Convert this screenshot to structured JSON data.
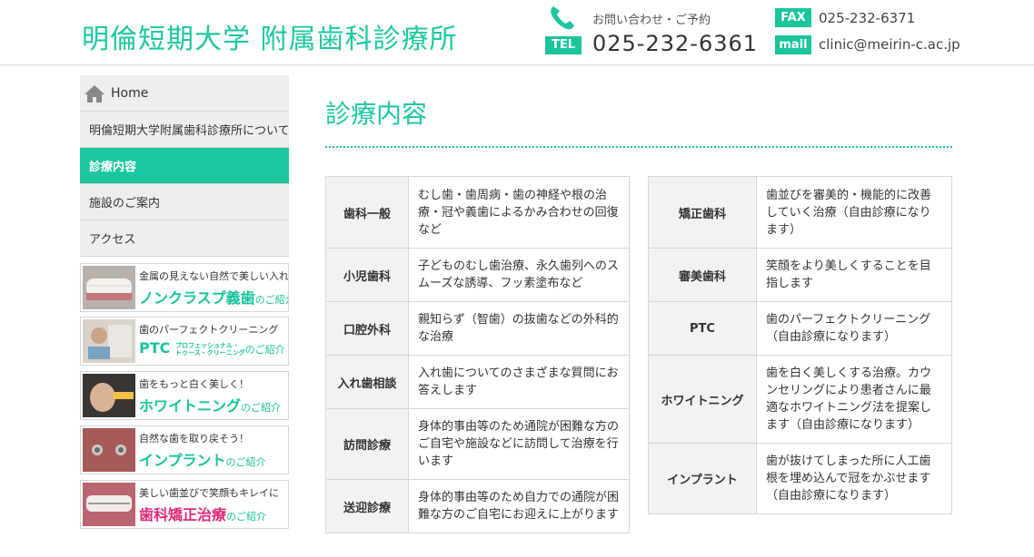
{
  "header": {
    "site_title": "明倫短期大学 附属歯科診療所",
    "inquiry_label": "お問い合わせ・ご予約",
    "tel_label": "TEL",
    "tel_number": "025-232-6361",
    "fax_label": "FAX",
    "fax_number": "025-232-6371",
    "mail_label": "mail",
    "mail_address": "clinic@meirin-c.ac.jp"
  },
  "nav": {
    "items": [
      {
        "label": "Home"
      },
      {
        "label": "明倫短期大学附属歯科診療所について"
      },
      {
        "label": "診療内容",
        "active": true
      },
      {
        "label": "施設のご案内"
      },
      {
        "label": "アクセス"
      }
    ]
  },
  "banners": [
    {
      "sub": "金属の見えない自然で美しい入れ歯",
      "main": "ノンクラスプ義歯",
      "intro": "のご紹介"
    },
    {
      "sub": "歯のパーフェクトクリーニング",
      "main": "PTC",
      "small1": "プロフェッショナル・",
      "small2": "トゥース・クリーニング",
      "intro": "のご紹介"
    },
    {
      "sub": "歯をもっと白く美しく！",
      "main": "ホワイトニング",
      "intro": "のご紹介"
    },
    {
      "sub": "自然な歯を取り戻そう！",
      "main": "インプラント",
      "intro": "のご紹介"
    },
    {
      "sub": "美しい歯並びで笑顔もキレイに",
      "main": "歯科矯正治療",
      "intro": "のご紹介"
    }
  ],
  "main": {
    "title": "診療内容",
    "left_table": [
      {
        "category": "歯科一般",
        "desc": "むし歯・歯周病・歯の神経や根の治療・冠や義歯によるかみ合わせの回復など"
      },
      {
        "category": "小児歯科",
        "desc": "子どものむし歯治療、永久歯列へのスムーズな誘導、フッ素塗布など"
      },
      {
        "category": "口腔外科",
        "desc": "親知らず（智歯）の抜歯などの外科的な治療"
      },
      {
        "category": "入れ歯相談",
        "desc": "入れ歯についてのさまざまな質問にお答えします"
      },
      {
        "category": "訪問診療",
        "desc": "身体的事由等のため通院が困難な方のご自宅や施設などに訪問して治療を行います"
      },
      {
        "category": "送迎診療",
        "desc": "身体的事由等のため自力での通院が困難な方のご自宅にお迎えに上がります"
      }
    ],
    "right_table": [
      {
        "category": "矯正歯科",
        "desc": "歯並びを審美的・機能的に改善していく治療（自由診療になります）"
      },
      {
        "category": "審美歯科",
        "desc": "笑顔をより美しくすることを目指します"
      },
      {
        "category": "PTC",
        "desc": "歯のパーフェクトクリーニング（自由診療になります）"
      },
      {
        "category": "ホワイトニング",
        "desc": "歯を白く美しくする治療。カウンセリングにより患者さんに最適なホワイトニング法を提案します（自由診療になります）"
      },
      {
        "category": "インプラント",
        "desc": "歯が抜けてしまった所に人工歯根を埋め込んで冠をかぶせます（自由診療になります）"
      }
    ]
  },
  "colors": {
    "accent": "#1dc8a0",
    "nav_bg": "#eeeeee",
    "banner_red": "#e02a7a"
  }
}
